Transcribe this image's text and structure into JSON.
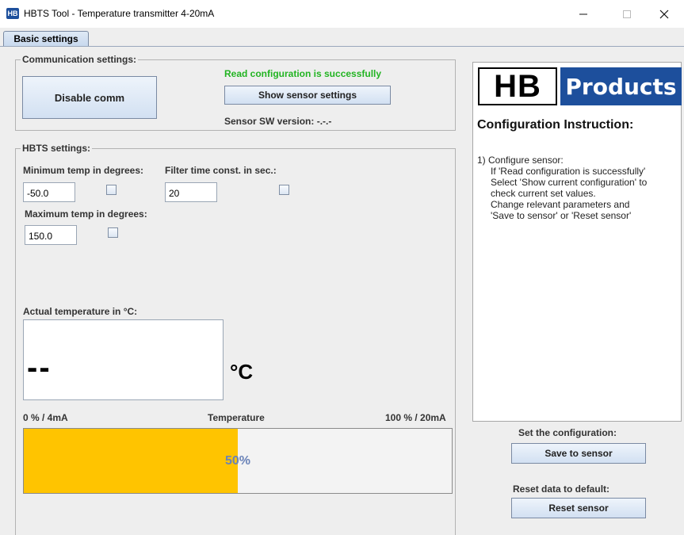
{
  "window": {
    "title": "HBTS Tool - Temperature transmitter 4-20mA",
    "app_icon_text": "HB",
    "minimize": "—",
    "maximize": "□",
    "close": "✕"
  },
  "tabs": [
    "Basic settings"
  ],
  "communication": {
    "group_title": "Communication settings:",
    "disable_button": "Disable comm",
    "status_text": "Read configuration is successfully",
    "status_color": "#22b422",
    "show_sensor_button": "Show sensor settings",
    "sw_version_label": "Sensor SW version: -.-.-"
  },
  "hbts": {
    "group_title": "HBTS settings:",
    "min_temp_label": "Minimum temp in degrees:",
    "min_temp_value": "-50.0",
    "filter_label": "Filter time const. in sec.:",
    "filter_value": "20",
    "max_temp_label": "Maximum temp in degrees:",
    "max_temp_value": "150.0",
    "actual_label": "Actual temperature in °C:",
    "actual_value": "--",
    "unit": "°C",
    "range_low": "0 % / 4mA",
    "range_mid": "Temperature",
    "range_high": "100 % / 20mA",
    "progress_percent": 50,
    "progress_text": "50%",
    "progress_color": "#ffc400"
  },
  "panel": {
    "logo_left": "HB",
    "logo_right": "Products",
    "heading": "Configuration Instruction:",
    "instructions": [
      "1) Configure sensor:",
      "If 'Read configuration is successfully'",
      "Select 'Show current configuration' to",
      "check current set values.",
      "Change relevant parameters and",
      "'Save to sensor' or 'Reset sensor'"
    ]
  },
  "actions": {
    "set_label": "Set the configuration:",
    "save_button": "Save to sensor",
    "reset_label": "Reset data to default:",
    "reset_button": "Reset sensor"
  }
}
